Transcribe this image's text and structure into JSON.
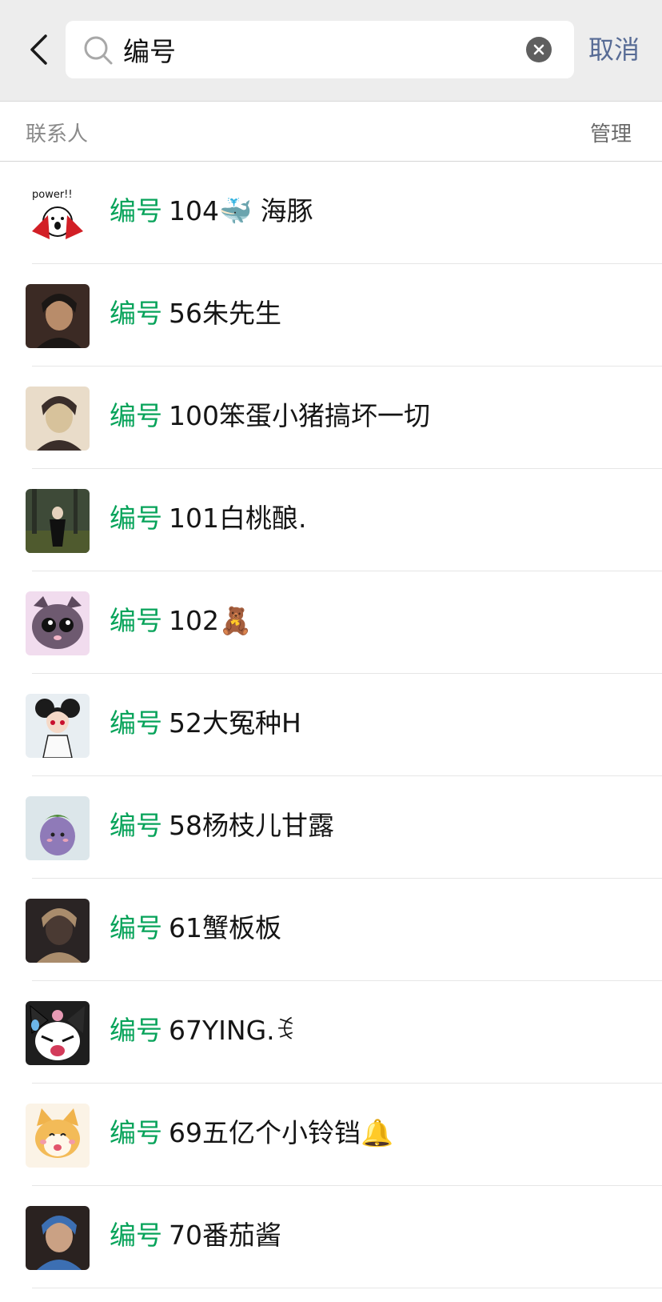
{
  "search": {
    "query": "编号",
    "cancel_label": "取消"
  },
  "section": {
    "title": "联系人",
    "manage_label": "管理"
  },
  "colors": {
    "highlight": "#07a35a",
    "link": "#576b95",
    "topbar": "#ededed"
  },
  "contacts": [
    {
      "highlight": "编号",
      "rest": "104🐳 海豚",
      "avatar": "power-sticker"
    },
    {
      "highlight": "编号",
      "rest": "56朱先生",
      "avatar": "photo"
    },
    {
      "highlight": "编号",
      "rest": "100笨蛋小猪搞坏一切",
      "avatar": "photo"
    },
    {
      "highlight": "编号",
      "rest": "101白桃酿.",
      "avatar": "photo"
    },
    {
      "highlight": "编号",
      "rest": "102🧸",
      "avatar": "cartoon-cat"
    },
    {
      "highlight": "编号",
      "rest": "52大冤种H",
      "avatar": "cartoon-girl"
    },
    {
      "highlight": "编号",
      "rest": "58杨枝儿甘露",
      "avatar": "eggplant"
    },
    {
      "highlight": "编号",
      "rest": "61蟹板板",
      "avatar": "photo"
    },
    {
      "highlight": "编号",
      "rest": "67YING.ꉂ",
      "avatar": "kuromi"
    },
    {
      "highlight": "编号",
      "rest": "69五亿个小铃铛🔔",
      "avatar": "shiba"
    },
    {
      "highlight": "编号",
      "rest": "70番茄酱",
      "avatar": "photo"
    }
  ]
}
